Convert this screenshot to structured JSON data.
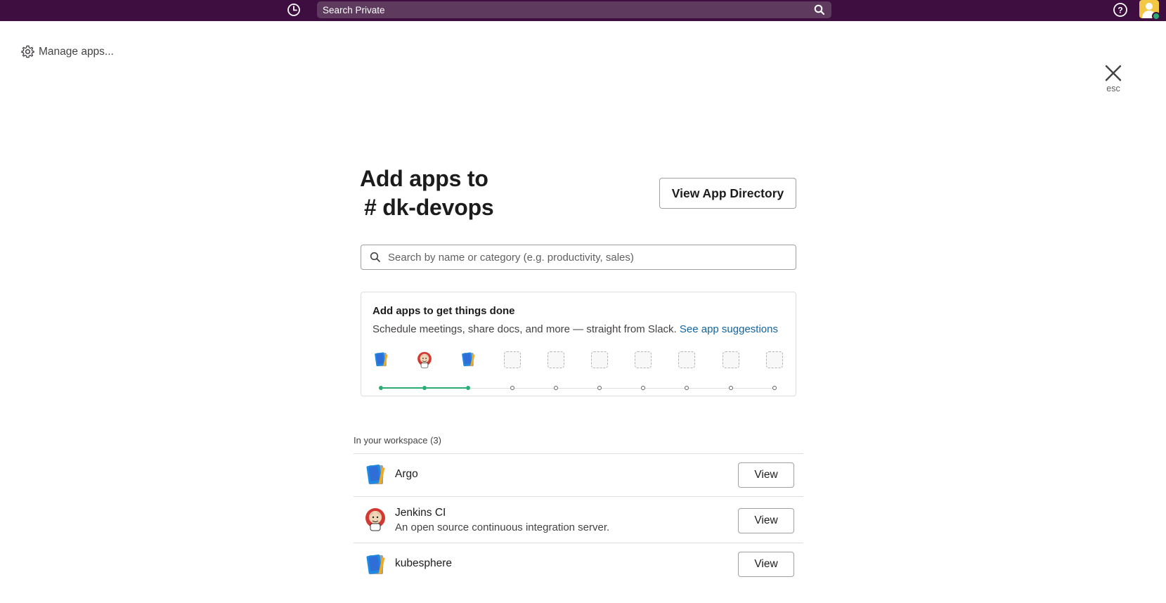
{
  "topbar": {
    "search_label": "Search Private",
    "bg_color": "#3f0e40"
  },
  "manage_apps": {
    "label": "Manage apps..."
  },
  "close": {
    "hint": "esc"
  },
  "header": {
    "title_line1": "Add apps to",
    "title_line2": "# dk-devops",
    "view_directory_label": "View App Directory"
  },
  "search": {
    "placeholder": "Search by name or category (e.g. productivity, sales)"
  },
  "suggestions": {
    "title": "Add apps to get things done",
    "description": "Schedule meetings, share docs, and more — straight from Slack. ",
    "link_label": "See app suggestions",
    "progress": {
      "added": 3,
      "total": 10
    },
    "slots": [
      "argo",
      "jenkins-ci",
      "kubesphere",
      "empty",
      "empty",
      "empty",
      "empty",
      "empty",
      "empty",
      "empty"
    ]
  },
  "workspace": {
    "heading": "In your workspace (3)",
    "apps": [
      {
        "name": "Argo",
        "description": "",
        "icon": "book-icon",
        "button": "View"
      },
      {
        "name": "Jenkins CI",
        "description": "An open source continuous integration server.",
        "icon": "jenkins-icon",
        "button": "View"
      },
      {
        "name": "kubesphere",
        "description": "",
        "icon": "book-icon",
        "button": "View"
      }
    ]
  },
  "colors": {
    "accent_green": "#2bac76",
    "link_blue": "#1264a3"
  }
}
